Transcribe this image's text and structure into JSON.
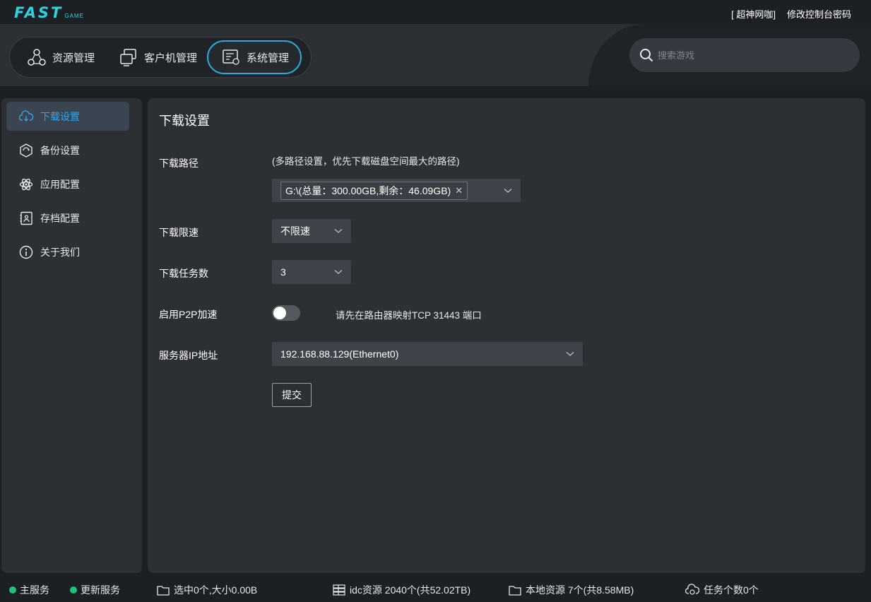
{
  "app": {
    "logo_main": "FAST",
    "logo_sub": "GAME",
    "header_links": [
      "[ 超神网咖]",
      "修改控制台密码"
    ]
  },
  "tabs": [
    {
      "label": "资源管理",
      "icon": "resources-icon",
      "active": false
    },
    {
      "label": "客户机管理",
      "icon": "clients-icon",
      "active": false
    },
    {
      "label": "系统管理",
      "icon": "system-icon",
      "active": true
    }
  ],
  "search": {
    "placeholder": "搜索游戏"
  },
  "sidebar": {
    "items": [
      {
        "label": "下载设置",
        "icon": "cloud-download-icon",
        "active": true
      },
      {
        "label": "备份设置",
        "icon": "backup-icon",
        "active": false
      },
      {
        "label": "应用配置",
        "icon": "atom-icon",
        "active": false
      },
      {
        "label": "存档配置",
        "icon": "archive-icon",
        "active": false
      },
      {
        "label": "关于我们",
        "icon": "info-icon",
        "active": false
      }
    ]
  },
  "main": {
    "title": "下载设置",
    "download_path": {
      "label": "下载路径",
      "hint": "(多路径设置，优先下载磁盘空间最大的路径)",
      "tags": [
        "G:\\(总量：300.00GB,剩余：46.09GB)"
      ]
    },
    "speed_limit": {
      "label": "下载限速",
      "value": "不限速"
    },
    "task_count": {
      "label": "下载任务数",
      "value": "3"
    },
    "p2p": {
      "label": "启用P2P加速",
      "enabled": false,
      "hint": "请先在路由器映射TCP 31443 端口"
    },
    "server_ip": {
      "label": "服务器IP地址",
      "value": "192.168.88.129(Ethernet0)"
    },
    "submit_label": "提交"
  },
  "status": {
    "main_service": "主服务",
    "update_service": "更新服务",
    "selected": "选中0个,大小0.00B",
    "idc": "idc资源 2040个(共52.02TB)",
    "local": "本地资源 7个(共8.58MB)",
    "tasks": "任务个数0个",
    "service_color": "#1fc27a"
  },
  "colors": {
    "accent": "#2aa8e0",
    "logo": "#2fd3e0"
  }
}
